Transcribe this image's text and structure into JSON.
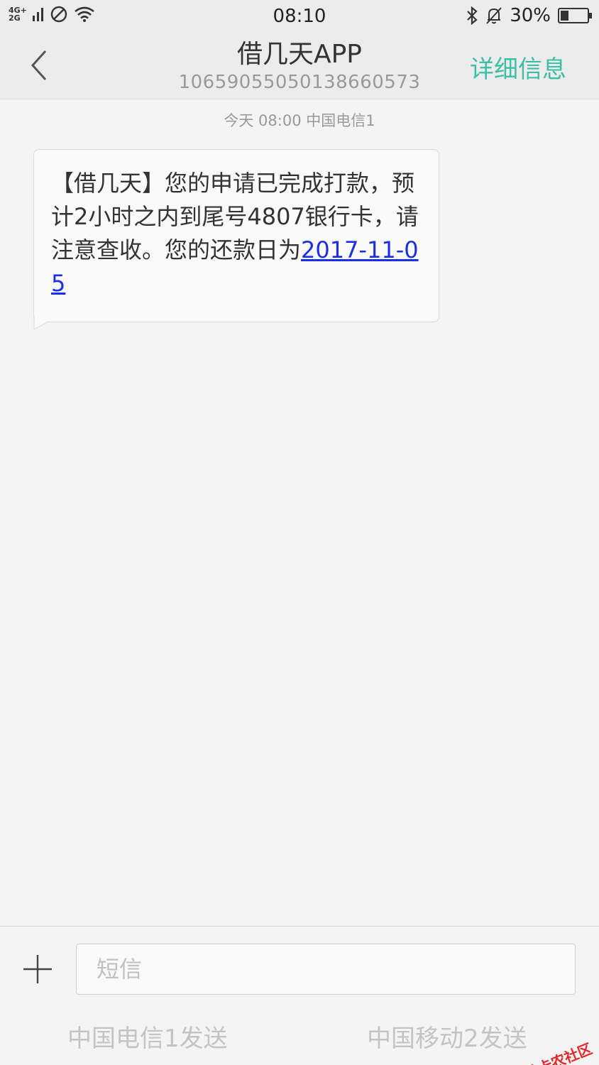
{
  "status_bar": {
    "network_top": "4G+",
    "network_bottom": "2G",
    "time": "08:10",
    "battery_text": "30%",
    "battery_level": 0.3,
    "icons": [
      "signal-icon",
      "no-disturb-icon",
      "wifi-icon",
      "bluetooth-icon",
      "alarm-off-icon",
      "battery-icon"
    ]
  },
  "header": {
    "title": "借几天APP",
    "subtitle": "10659055050138660573",
    "detail_label": "详细信息",
    "accent_color": "#3cbfa4"
  },
  "conversation": {
    "meta": "今天  08:00  中国电信1",
    "message_text": "【借几天】您的申请已完成打款，预计2小时之内到尾号4807银行卡，请注意查收。您的还款日为",
    "message_link": "2017-11-05",
    "link_color": "#1a2fe6"
  },
  "compose": {
    "input_placeholder": "短信",
    "input_value": "",
    "send1_label": "中国电信1发送",
    "send2_label": "中国移动2发送"
  },
  "watermark": {
    "text": "卡农社区"
  }
}
